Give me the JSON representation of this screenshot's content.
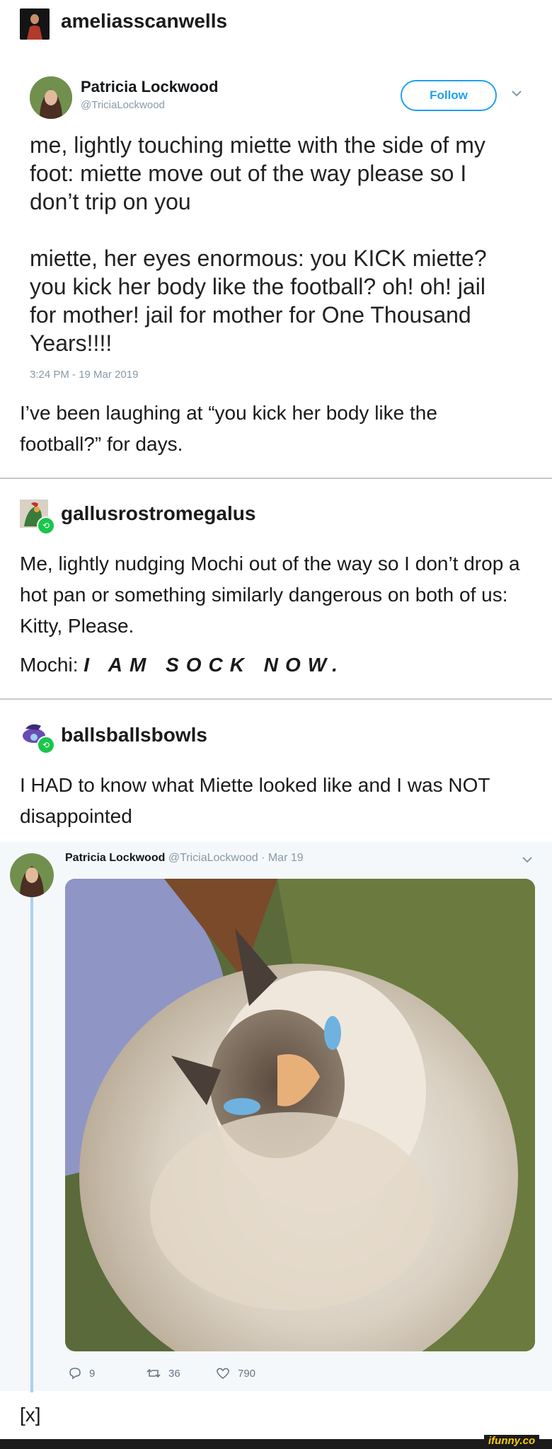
{
  "post": {
    "op_username": "ameliasscanwells",
    "tweet": {
      "name": "Patricia Lockwood",
      "handle": "@TriciaLockwood",
      "follow_label": "Follow",
      "para1": "me, lightly touching miette with the side of my foot: miette move out of the way please so I don’t trip on you",
      "para2": "miette, her eyes enormous: you KICK miette? you kick her body like the football? oh! oh! jail for mother! jail for mother for One Thousand Years!!!!",
      "timestamp": "3:24 PM - 19 Mar 2019"
    },
    "op_comment": "I’ve been laughing at “you kick her body like the football?” for days."
  },
  "reblog1": {
    "username": "gallusrostromegalus",
    "text1": "Me, lightly nudging Mochi out of the way so I don’t drop a hot pan or something similarly dangerous on both of us: Kitty, Please.",
    "text2_prefix": "Mochi:",
    "text2_emph": "I AM SOCK NOW."
  },
  "reblog2": {
    "username": "ballsballsbowls",
    "text": "I HAD to know what Miette looked like and I was NOT disappointed",
    "embedded_tweet": {
      "name": "Patricia Lockwood",
      "handle_date": "@TriciaLockwood · Mar 19",
      "replies": "9",
      "retweets": "36",
      "likes": "790"
    }
  },
  "footer": {
    "source_mark": "[x]",
    "watermark": "ifunny.co"
  },
  "colors": {
    "twitter_blue": "#1da1f2",
    "reblog_green": "#18c64a",
    "divider": "#c9c9c9"
  }
}
